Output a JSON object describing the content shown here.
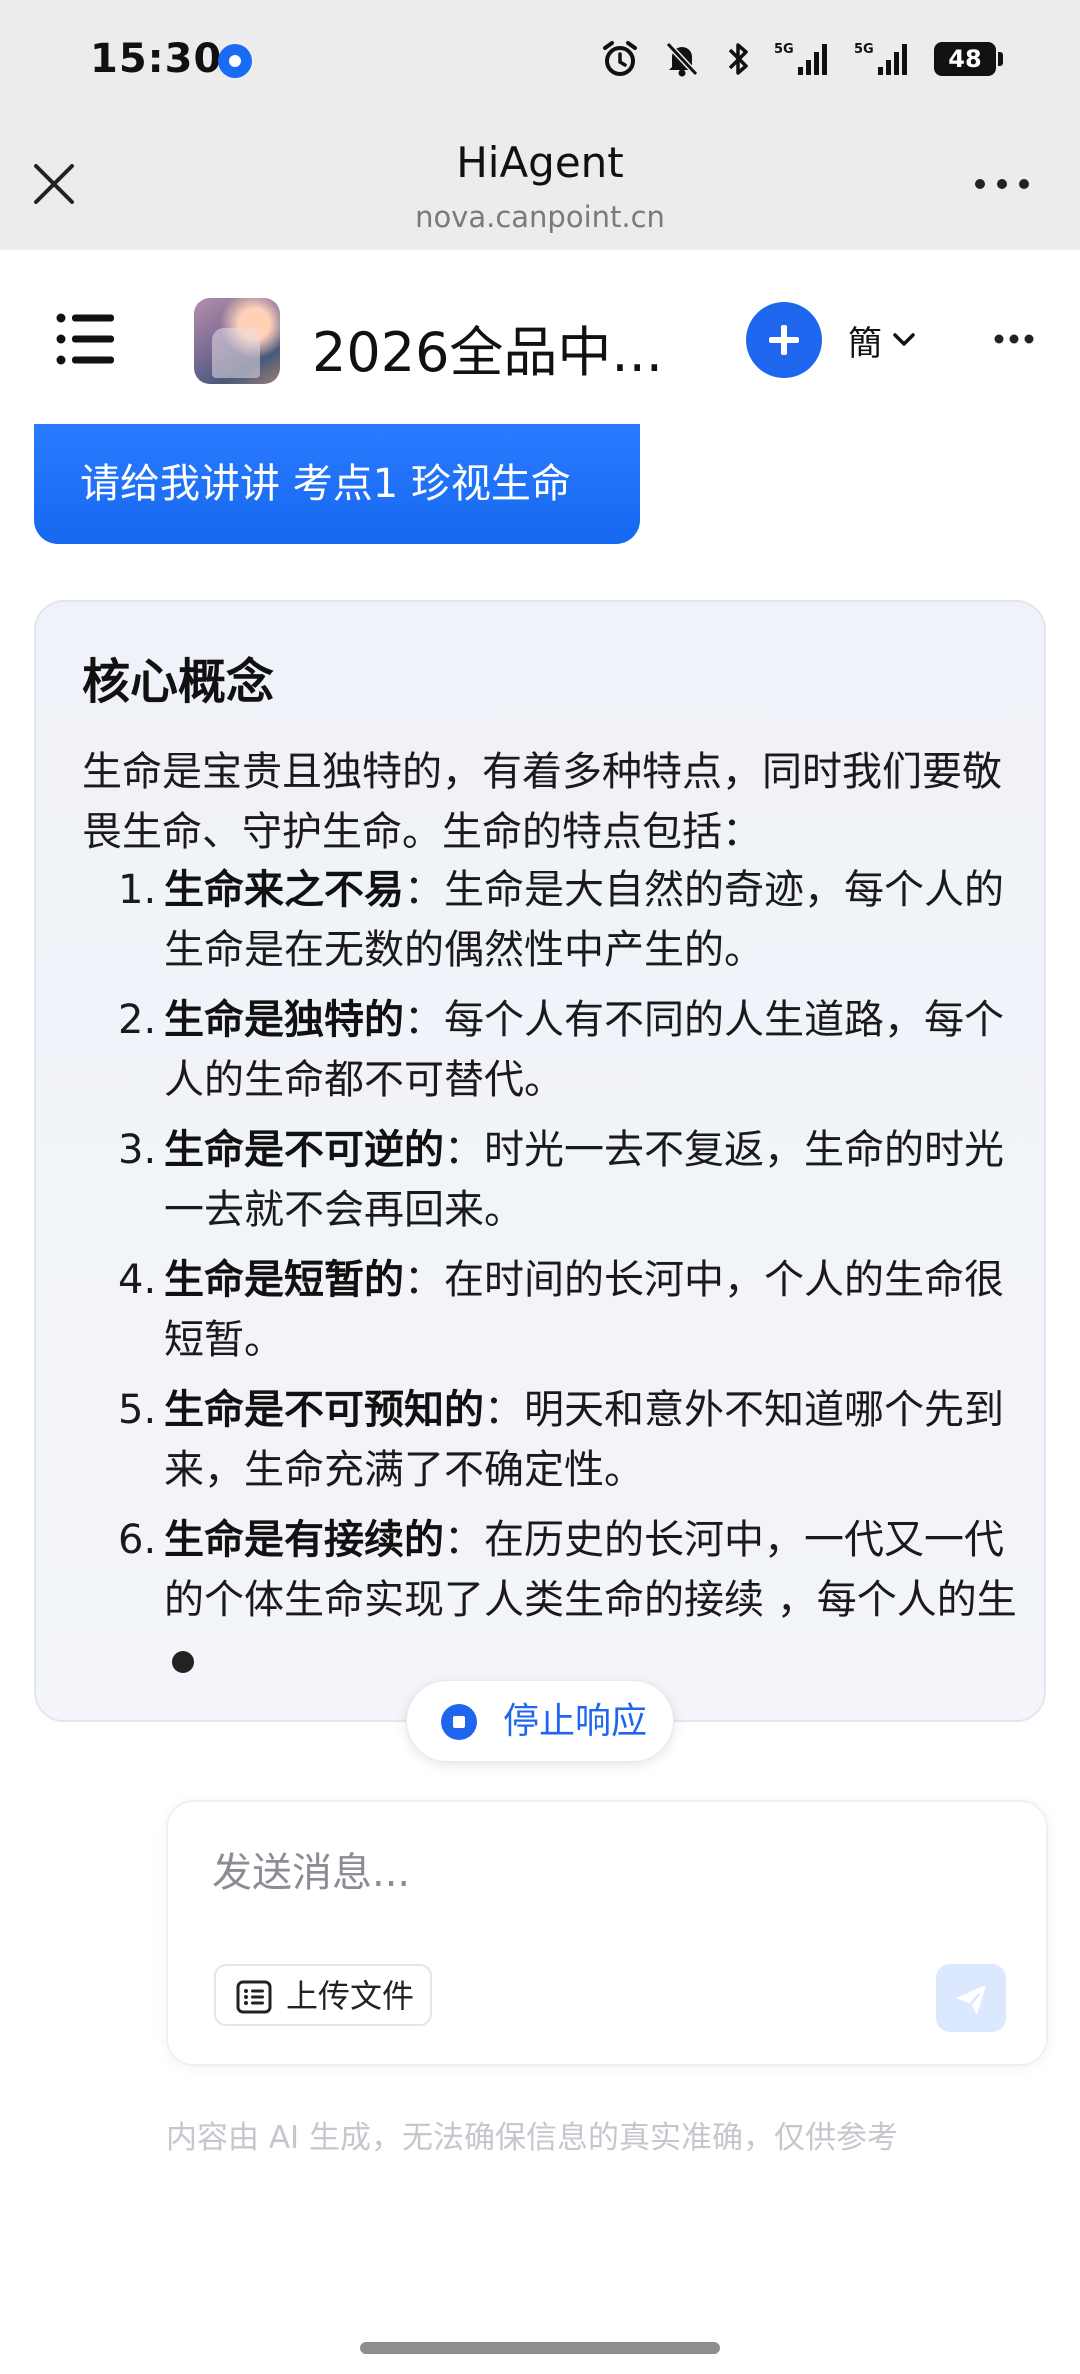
{
  "status_bar": {
    "time": "15:30",
    "battery": "48",
    "icons": [
      "alarm-icon",
      "bell-off-icon",
      "bluetooth-icon",
      "signal-5g-icon",
      "signal-5g-icon",
      "battery-icon"
    ]
  },
  "browser_bar": {
    "title": "HiAgent",
    "url": "nova.canpoint.cn"
  },
  "app_header": {
    "chat_title": "2026全品中...",
    "language_label": "簡"
  },
  "chat": {
    "user_message": "请给我讲讲 考点1 珍视生命",
    "answer": {
      "title": "核心概念",
      "intro": "生命是宝贵且独特的，有着多种特点，同时我们要敬畏生命、守护生命。生命的特点包括：",
      "items": [
        {
          "num": "1.",
          "bold": "生命来之不易",
          "text": "：生命是大自然的奇迹，每个人的生命是在无数的偶然性中产生的。"
        },
        {
          "num": "2.",
          "bold": "生命是独特的",
          "text": "：每个人有不同的人生道路，每个人的生命都不可替代。"
        },
        {
          "num": "3.",
          "bold": "生命是不可逆的",
          "text": "：时光一去不复返，生命的时光一去就不会再回来。"
        },
        {
          "num": "4.",
          "bold": "生命是短暂的",
          "text": "：在时间的长河中，个人的生命很短暂。"
        },
        {
          "num": "5.",
          "bold": "生命是不可预知的",
          "text": "：明天和意外不知道哪个先到来，生命充满了不确定性。"
        },
        {
          "num": "6.",
          "bold": "生命是有接续的",
          "text": "：在历史的长河中，一代又一代的个体生命实现了人类生命的接续 ，每个人的生"
        }
      ]
    },
    "stop_label": "停止响应"
  },
  "input": {
    "placeholder": "发送消息...",
    "value": "",
    "upload_label": "上传文件"
  },
  "disclaimer": "内容由 AI 生成，无法确保信息的真实准确，仅供参考",
  "colors": {
    "accent": "#1f66ee",
    "user_bubble": "#1668f0",
    "card_bg": "#eff2f8",
    "top_bar_bg": "#ececec"
  }
}
